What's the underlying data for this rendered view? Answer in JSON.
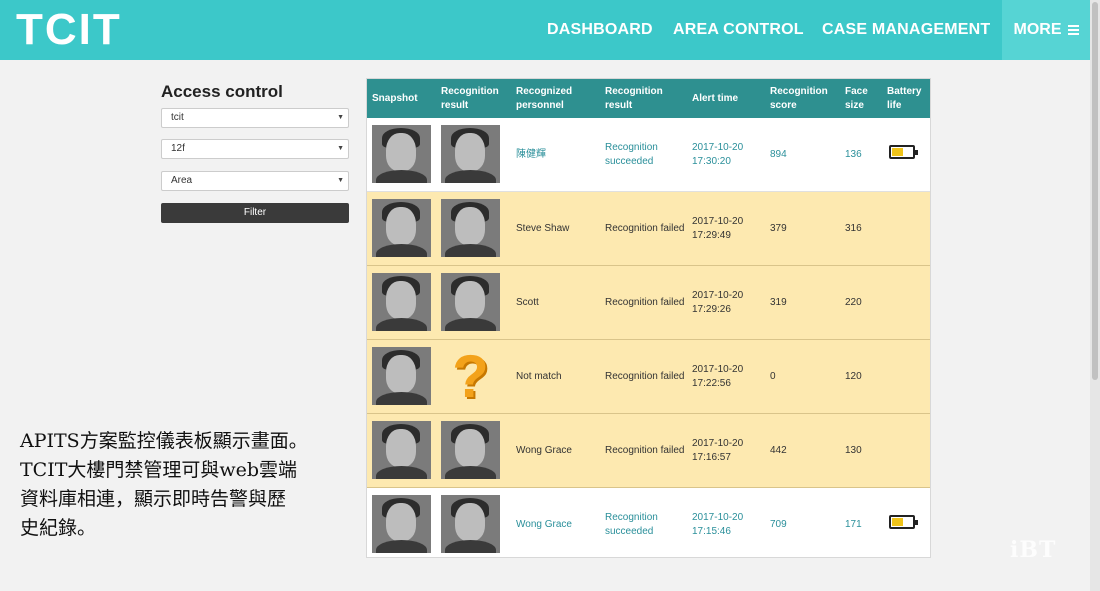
{
  "header": {
    "logo": "TCIT",
    "nav": [
      "DASHBOARD",
      "AREA CONTROL",
      "CASE MANAGEMENT"
    ],
    "more_label": "MORE"
  },
  "sidebar": {
    "title": "Access control",
    "selects": [
      "tcit",
      "12f",
      "Area"
    ],
    "filter_label": "Filter"
  },
  "table": {
    "columns": [
      "Snapshot",
      "Recognition result",
      "Recognized personnel",
      "Recognition result",
      "Alert time",
      "Recognition score",
      "Face size",
      "Battery life"
    ],
    "rows": [
      {
        "personnel": "陳健輝",
        "result": "Recognition succeeded",
        "date": "2017-10-20",
        "time": "17:30:20",
        "score": "894",
        "face_size": "136",
        "status": "success",
        "battery": 0.6,
        "unknown": false
      },
      {
        "personnel": "Steve Shaw",
        "result": "Recognition failed",
        "date": "2017-10-20",
        "time": "17:29:49",
        "score": "379",
        "face_size": "316",
        "status": "failed",
        "battery": null,
        "unknown": false
      },
      {
        "personnel": "Scott",
        "result": "Recognition failed",
        "date": "2017-10-20",
        "time": "17:29:26",
        "score": "319",
        "face_size": "220",
        "status": "failed",
        "battery": null,
        "unknown": false
      },
      {
        "personnel": "Not match",
        "result": "Recognition failed",
        "date": "2017-10-20",
        "time": "17:22:56",
        "score": "0",
        "face_size": "120",
        "status": "failed",
        "battery": null,
        "unknown": true
      },
      {
        "personnel": "Wong Grace",
        "result": "Recognition failed",
        "date": "2017-10-20",
        "time": "17:16:57",
        "score": "442",
        "face_size": "130",
        "status": "failed",
        "battery": null,
        "unknown": false
      },
      {
        "personnel": "Wong Grace",
        "result": "Recognition succeeded",
        "date": "2017-10-20",
        "time": "17:15:46",
        "score": "709",
        "face_size": "171",
        "status": "success",
        "battery": 0.6,
        "unknown": false
      }
    ]
  },
  "caption": {
    "lines": [
      "APITS方案監控儀表板顯示畫面。",
      "TCIT大樓門禁管理可與web雲端",
      "資料庫相連，顯示即時告警與歷",
      "史紀錄。"
    ]
  },
  "watermark": "iBT",
  "colors": {
    "header": "#3cc8c9",
    "table_header": "#2e9090",
    "failed_row": "#fde9b0",
    "success_text": "#2a8f9a",
    "battery": "#f0c419"
  }
}
